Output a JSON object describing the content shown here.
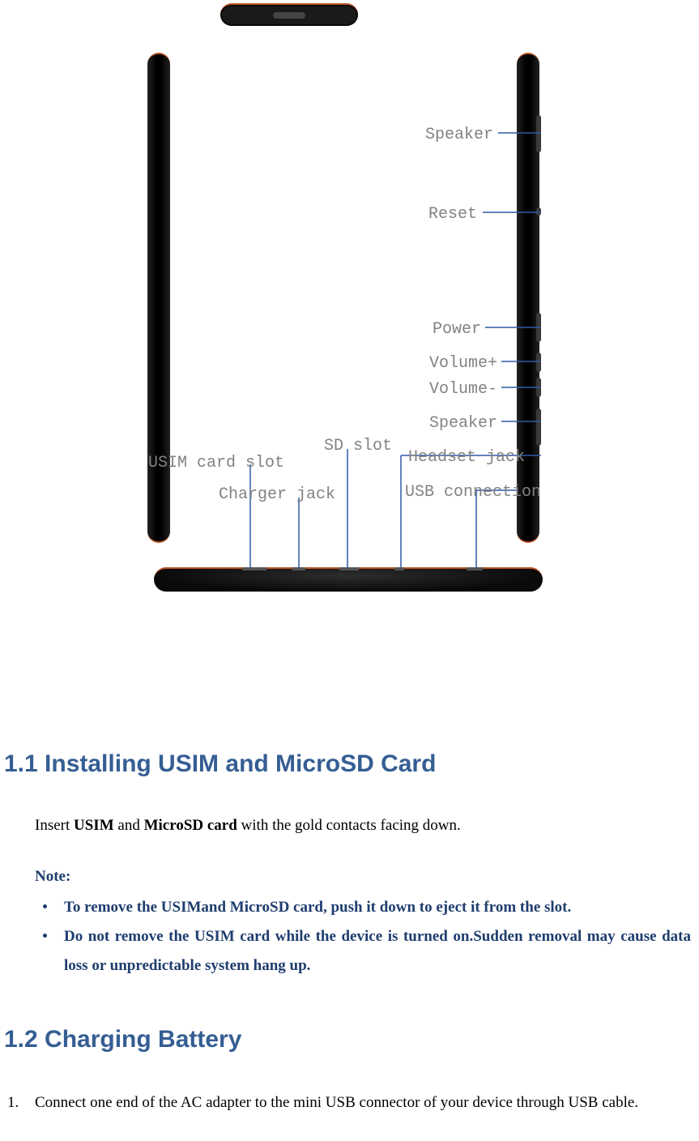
{
  "diagram": {
    "labels_right": {
      "speaker_top": "Speaker",
      "reset": "Reset",
      "power": "Power",
      "volume_up": "Volume+",
      "volume_down": "Volume-",
      "speaker_bottom": "Speaker",
      "headset": "Headset jack",
      "usb": "USB connection"
    },
    "labels_bottom": {
      "usim": "USIM card slot",
      "charger": "Charger jack",
      "sd": "SD slot"
    }
  },
  "sections": {
    "s1_1": {
      "heading": "1.1 Installing USIM and MicroSD Card",
      "p_prefix": "Insert ",
      "p_bold1": "USIM",
      "p_mid": " and ",
      "p_bold2": "MicroSD card",
      "p_suffix": " with the gold contacts facing down.",
      "note_label": "Note:",
      "notes": {
        "0": "To remove the USIMand MicroSD card, push it down to eject it from the slot.",
        "1": "Do not remove the USIM card while the device is turned on.Sudden removal may cause data loss or unpredictable system hang up."
      }
    },
    "s1_2": {
      "heading": "1.2 Charging Battery",
      "steps": {
        "0": "Connect one end of the AC adapter to the mini USB connector of your device through USB cable."
      }
    }
  }
}
